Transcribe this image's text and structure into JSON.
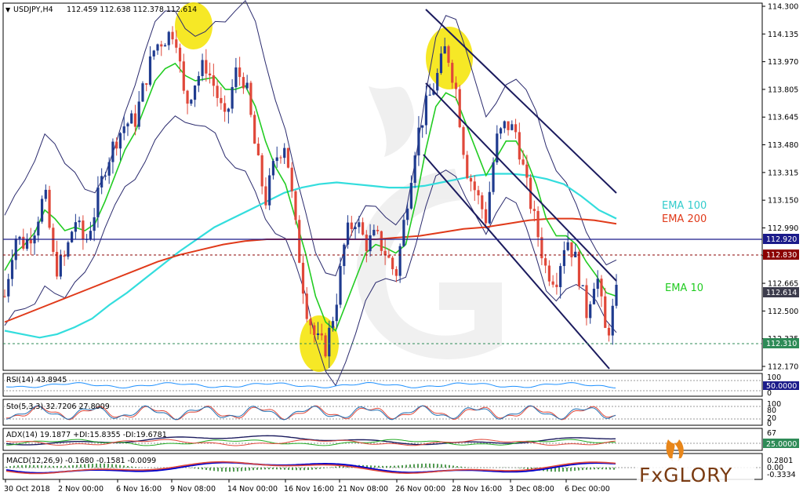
{
  "header": {
    "symbol": "USDJPY,H4",
    "ohlc": "112.459 112.638 112.378 112.614"
  },
  "colors": {
    "bull": "#1f3b8f",
    "bear": "#e0483a",
    "ema10": "#22cc22",
    "ema100": "#33dddd",
    "ema200": "#e03a1a",
    "bollinger": "#2b2b6e",
    "channel": "#1b1b5e",
    "highlight": "#f5e400",
    "resistance": "#1b1b8a",
    "level_red": "#8b0000",
    "support": "#2e8b57",
    "price_box": "#3c3c4c"
  },
  "legend": {
    "ema100": "EMA 100",
    "ema200": "EMA 200",
    "ema10": "EMA 10"
  },
  "price_labels": {
    "resistance": "112.920",
    "level_red": "112.830",
    "current": "112.614",
    "support": "112.310"
  },
  "panels": {
    "rsi": {
      "title": "RSI(14) 43.8945",
      "ticks": [
        "100",
        "50.0000",
        "0"
      ],
      "value_box": "50.0000"
    },
    "sto": {
      "title": "Sto(5,3,3) 32.7206 27.8009",
      "ticks": [
        "100",
        "80",
        "20",
        "0"
      ]
    },
    "adx": {
      "title": "ADX(14) 19.1877 +DI:15.8355 -DI:19.6781",
      "ticks": [
        "67",
        "25.0000"
      ],
      "value_box": "25.0000"
    },
    "macd": {
      "title": "MACD(12,26,9) -0.1680 -0.1581 -0.0099",
      "ticks": [
        "0.2801",
        "0.00",
        "-0.3334"
      ]
    }
  },
  "brand": {
    "logo_text": "FxGLORY"
  },
  "chart_data": {
    "type": "candlestick",
    "title": "USDJPY,H4",
    "y_ticks": [
      "114.300",
      "114.135",
      "113.970",
      "113.805",
      "113.645",
      "113.480",
      "113.315",
      "113.150",
      "112.990",
      "112.825",
      "112.665",
      "112.500",
      "112.335",
      "112.170"
    ],
    "ylim": [
      112.17,
      114.3
    ],
    "x_ticks": [
      "30 Oct 2018",
      "2 Nov 00:00",
      "6 Nov 16:00",
      "9 Nov 08:00",
      "14 Nov 00:00",
      "16 Nov 16:00",
      "21 Nov 08:00",
      "26 Nov 00:00",
      "28 Nov 16:00",
      "3 Dec 08:00",
      "6 Dec 00:00"
    ],
    "close_path": [
      112.6,
      112.95,
      112.9,
      113.0,
      113.2,
      112.75,
      112.82,
      113.05,
      112.9,
      113.1,
      113.35,
      113.5,
      113.6,
      113.62,
      113.85,
      114.05,
      114.1,
      114.15,
      113.7,
      113.85,
      113.95,
      113.8,
      113.6,
      113.9,
      113.85,
      113.45,
      113.15,
      113.4,
      113.5,
      113.0,
      112.55,
      112.35,
      112.3,
      112.55,
      112.95,
      113.05,
      112.9,
      112.95,
      112.85,
      112.72,
      113.1,
      113.5,
      113.7,
      113.85,
      114.05,
      113.8,
      113.35,
      113.2,
      113.05,
      113.5,
      113.6,
      113.55,
      113.25,
      113.0,
      112.75,
      112.7,
      112.95,
      112.8,
      112.5,
      112.75,
      112.35,
      112.61
    ],
    "series": [
      {
        "name": "EMA 10",
        "values": [
          112.75,
          112.85,
          112.9,
          112.97,
          113.1,
          113.05,
          112.98,
          113.0,
          112.98,
          113.02,
          113.15,
          113.3,
          113.45,
          113.55,
          113.7,
          113.85,
          113.92,
          113.95,
          113.88,
          113.85,
          113.86,
          113.87,
          113.8,
          113.8,
          113.82,
          113.7,
          113.5,
          113.35,
          113.25,
          113.05,
          112.85,
          112.6,
          112.45,
          112.4,
          112.55,
          112.7,
          112.85,
          112.9,
          112.88,
          112.85,
          112.9,
          113.15,
          113.45,
          113.7,
          113.78,
          113.75,
          113.6,
          113.45,
          113.3,
          113.4,
          113.5,
          113.5,
          113.4,
          113.25,
          113.05,
          112.95,
          112.95,
          112.9,
          112.8,
          112.72,
          112.62,
          112.6
        ]
      },
      {
        "name": "EMA 100",
        "values": [
          112.4,
          112.38,
          112.36,
          112.38,
          112.42,
          112.47,
          112.55,
          112.62,
          112.7,
          112.78,
          112.86,
          112.93,
          113.0,
          113.05,
          113.1,
          113.15,
          113.2,
          113.23,
          113.25,
          113.26,
          113.25,
          113.24,
          113.23,
          113.23,
          113.24,
          113.26,
          113.28,
          113.3,
          113.31,
          113.31,
          113.3,
          113.28,
          113.25,
          113.18,
          113.1,
          113.05
        ]
      },
      {
        "name": "EMA 200",
        "values": [
          112.45,
          112.5,
          112.55,
          112.6,
          112.65,
          112.7,
          112.75,
          112.8,
          112.84,
          112.87,
          112.9,
          112.92,
          112.93,
          112.93,
          112.93,
          112.93,
          112.93,
          112.93,
          112.94,
          112.95,
          112.97,
          112.99,
          113.0,
          113.02,
          113.04,
          113.05,
          113.05,
          113.04,
          113.02
        ]
      }
    ],
    "annotations": [
      "resistance 112.920",
      "support 112.310",
      "descending channel",
      "EMA 10",
      "EMA 100",
      "EMA 200"
    ]
  }
}
